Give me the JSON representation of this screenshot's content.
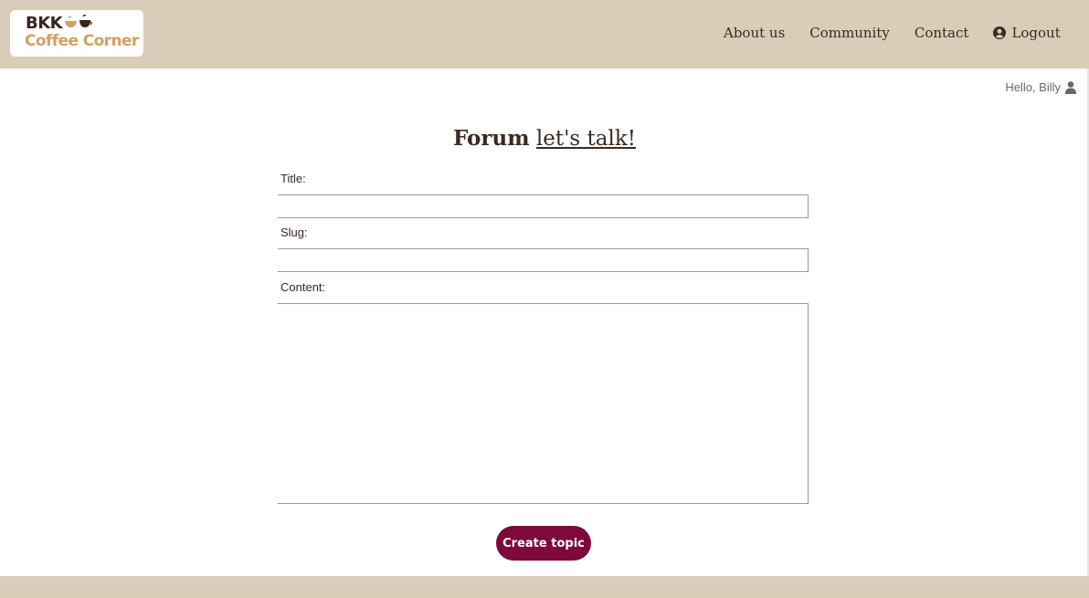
{
  "brand": {
    "line1": "BKK",
    "line2": "Coffee Corner",
    "colors": {
      "dark": "#3b2418",
      "gold": "#d3a061"
    }
  },
  "nav": {
    "about": "About us",
    "community": "Community",
    "contact": "Contact",
    "logout": "Logout",
    "logout_icon": "user-circle-icon"
  },
  "user": {
    "greeting": "Hello, Billy",
    "icon": "user-icon"
  },
  "page": {
    "title_bold": "Forum",
    "title_link": "let's talk!"
  },
  "form": {
    "title_label": "Title:",
    "title_value": "",
    "slug_label": "Slug:",
    "slug_value": "",
    "content_label": "Content:",
    "content_value": "",
    "submit_label": "Create topic"
  },
  "colors": {
    "header_bg": "#dbcbb9",
    "button_bg": "#7d0a3b",
    "text": "#3a2a22"
  }
}
